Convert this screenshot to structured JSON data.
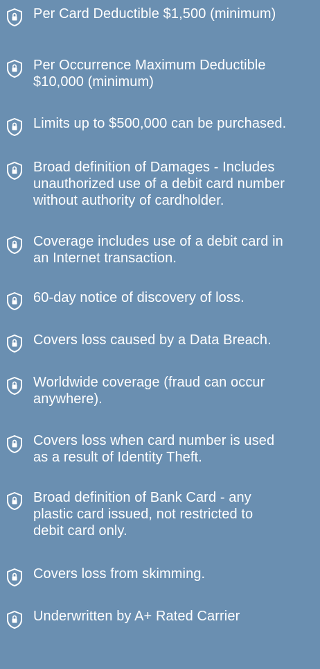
{
  "features": [
    {
      "icon": "shield-lock-icon",
      "lines": [
        "Per Card Deductible $1,500 (minimum)"
      ]
    },
    {
      "icon": "shield-lock-icon",
      "lines": [
        "Per Occurrence Maximum Deductible",
        "$10,000 (minimum)"
      ]
    },
    {
      "icon": "shield-lock-icon",
      "lines": [
        "Limits up to $500,000 can be purchased."
      ]
    },
    {
      "icon": "shield-lock-icon",
      "lines": [
        "Broad definition of Damages - Includes",
        "unauthorized use of a debit card number",
        "without authority of cardholder."
      ]
    },
    {
      "icon": "shield-lock-icon",
      "lines": [
        "Coverage includes use of a debit card in",
        "an Internet transaction."
      ]
    },
    {
      "icon": "shield-lock-icon",
      "lines": [
        "60-day notice of discovery of loss."
      ]
    },
    {
      "icon": "shield-lock-icon",
      "lines": [
        "Covers loss caused by a Data Breach."
      ]
    },
    {
      "icon": "shield-lock-icon",
      "lines": [
        "Worldwide coverage (fraud can occur",
        "anywhere)."
      ]
    },
    {
      "icon": "shield-lock-icon",
      "lines": [
        "Covers loss when card number is used",
        "as a result of Identity Theft."
      ]
    },
    {
      "icon": "shield-lock-icon",
      "lines": [
        "Broad definition of Bank Card - any",
        "plastic card issued, not restricted to",
        "debit card only."
      ]
    },
    {
      "icon": "shield-lock-icon",
      "lines": [
        "Covers loss from skimming."
      ]
    },
    {
      "icon": "shield-lock-icon",
      "lines": [
        "Underwritten by A+ Rated Carrier"
      ]
    }
  ]
}
